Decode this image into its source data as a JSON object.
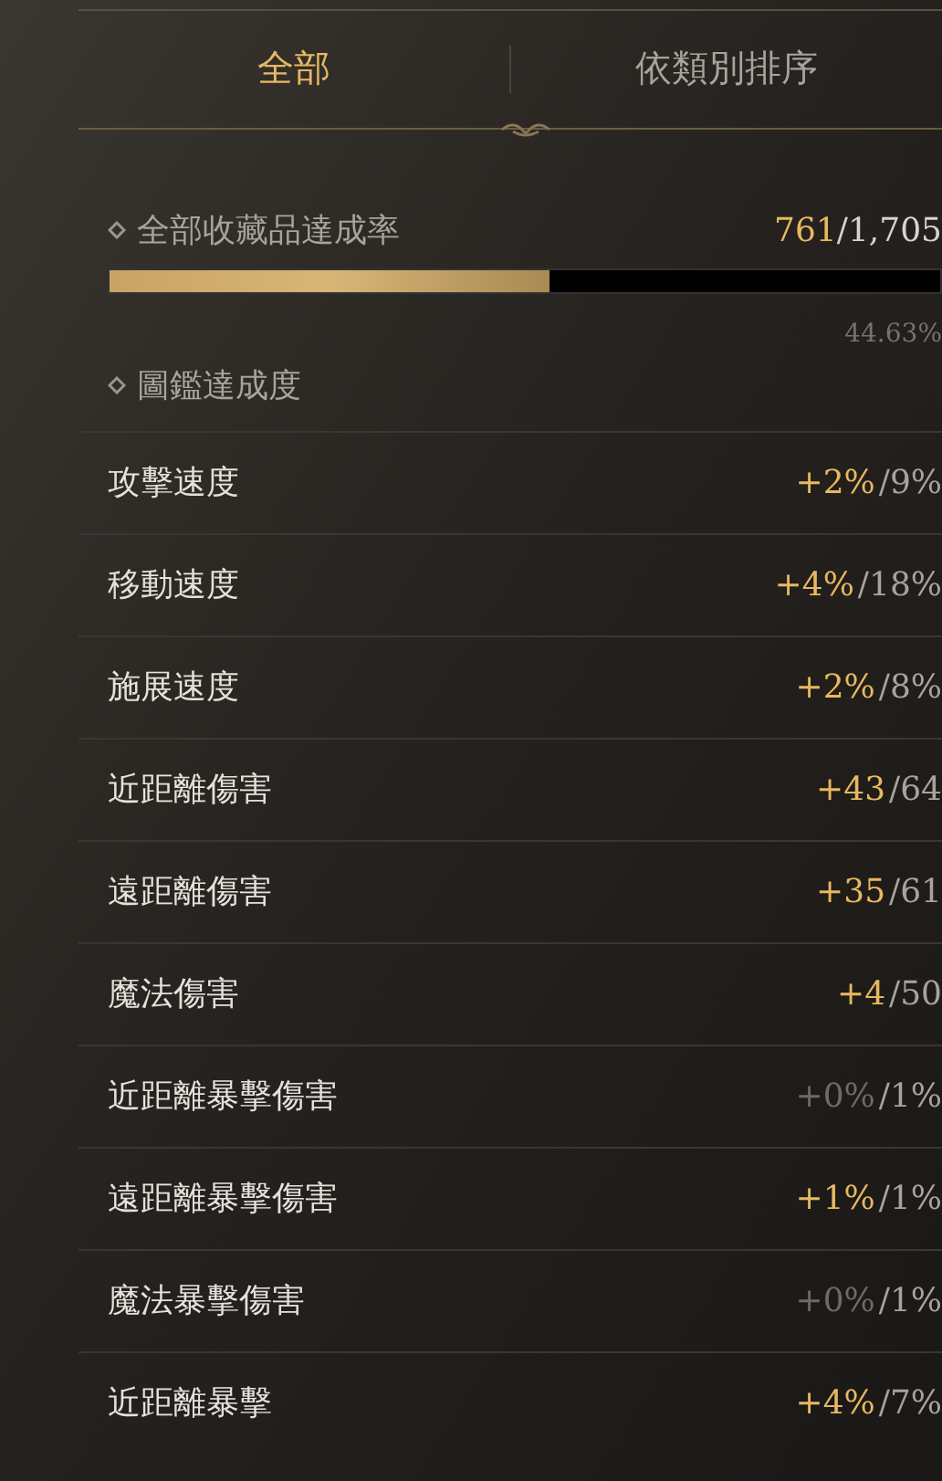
{
  "tabs": [
    {
      "label": "全部",
      "selected": true
    },
    {
      "label": "依類別排序",
      "selected": false
    }
  ],
  "collection": {
    "label": "全部收藏品達成率",
    "count": "761",
    "total": "/1,705",
    "level": 0.53,
    "percent": "44.63%"
  },
  "section": {
    "label": "圖鑑達成度"
  },
  "stats": [
    {
      "name": "攻擊速度",
      "bonus": "+2%",
      "max": "/9%",
      "active": true
    },
    {
      "name": "移動速度",
      "bonus": "+4%",
      "max": "/18%",
      "active": true
    },
    {
      "name": "施展速度",
      "bonus": "+2%",
      "max": "/8%",
      "active": true
    },
    {
      "name": "近距離傷害",
      "bonus": "+43",
      "max": "/64",
      "active": true
    },
    {
      "name": "遠距離傷害",
      "bonus": "+35",
      "max": "/61",
      "active": true
    },
    {
      "name": "魔法傷害",
      "bonus": "+4",
      "max": "/50",
      "active": true
    },
    {
      "name": "近距離暴擊傷害",
      "bonus": "+0%",
      "max": "/1%",
      "active": false
    },
    {
      "name": "遠距離暴擊傷害",
      "bonus": "+1%",
      "max": "/1%",
      "active": true
    },
    {
      "name": "魔法暴擊傷害",
      "bonus": "+0%",
      "max": "/1%",
      "active": false
    },
    {
      "name": "近距離暴擊",
      "bonus": "+4%",
      "max": "/7%",
      "active": true
    }
  ]
}
